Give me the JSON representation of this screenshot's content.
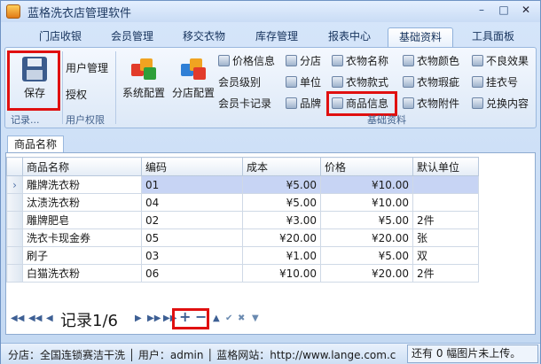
{
  "window": {
    "title": "蓝格洗衣店管理软件",
    "min": "–",
    "max": "□",
    "close": "✕"
  },
  "menu_tabs": [
    {
      "label": "门店收银"
    },
    {
      "label": "会员管理"
    },
    {
      "label": "移交衣物"
    },
    {
      "label": "库存管理"
    },
    {
      "label": "报表中心"
    },
    {
      "label": "基础资料"
    },
    {
      "label": "工具面板"
    }
  ],
  "ribbon": {
    "save_label": "保存",
    "group1_caption": "记录...",
    "user_mgmt": "用户管理",
    "authorize": "授权",
    "group2_caption": "用户权限",
    "system_config": "系统配置",
    "branch_config": "分店配置",
    "small_col1": [
      "价格信息",
      "会员级别",
      "会员卡记录"
    ],
    "small_col2": [
      "分店",
      "单位",
      "品牌"
    ],
    "small_col3": [
      "衣物名称",
      "衣物款式",
      "商品信息"
    ],
    "small_col4": [
      "衣物颜色",
      "衣物瑕疵",
      "衣物附件"
    ],
    "small_col5": [
      "不良效果",
      "挂衣号",
      "兑换内容"
    ],
    "group3_caption": "基础资料"
  },
  "doc_tab": "商品名称",
  "table": {
    "headers": [
      "商品名称",
      "编码",
      "成本",
      "价格",
      "默认单位"
    ],
    "rows": [
      [
        "雕牌洗衣粉",
        "01",
        "¥5.00",
        "¥10.00",
        ""
      ],
      [
        "汰渍洗衣粉",
        "04",
        "¥5.00",
        "¥10.00",
        ""
      ],
      [
        "雕牌肥皂",
        "02",
        "¥3.00",
        "¥5.00",
        "2件"
      ],
      [
        "洗衣卡现金券",
        "05",
        "¥20.00",
        "¥20.00",
        "张"
      ],
      [
        "刷子",
        "03",
        "¥1.00",
        "¥5.00",
        "双"
      ],
      [
        "白猫洗衣粉",
        "06",
        "¥10.00",
        "¥20.00",
        "2件"
      ]
    ]
  },
  "navigator": {
    "record_label": "记录1/6",
    "add": "+",
    "remove": "−"
  },
  "status": {
    "left": "分店：全国连锁赛洁干洗 │ 用户：admin │ 蓝格网站：http://www.lange.com.c",
    "right": "还有 0 幅图片未上传。"
  }
}
